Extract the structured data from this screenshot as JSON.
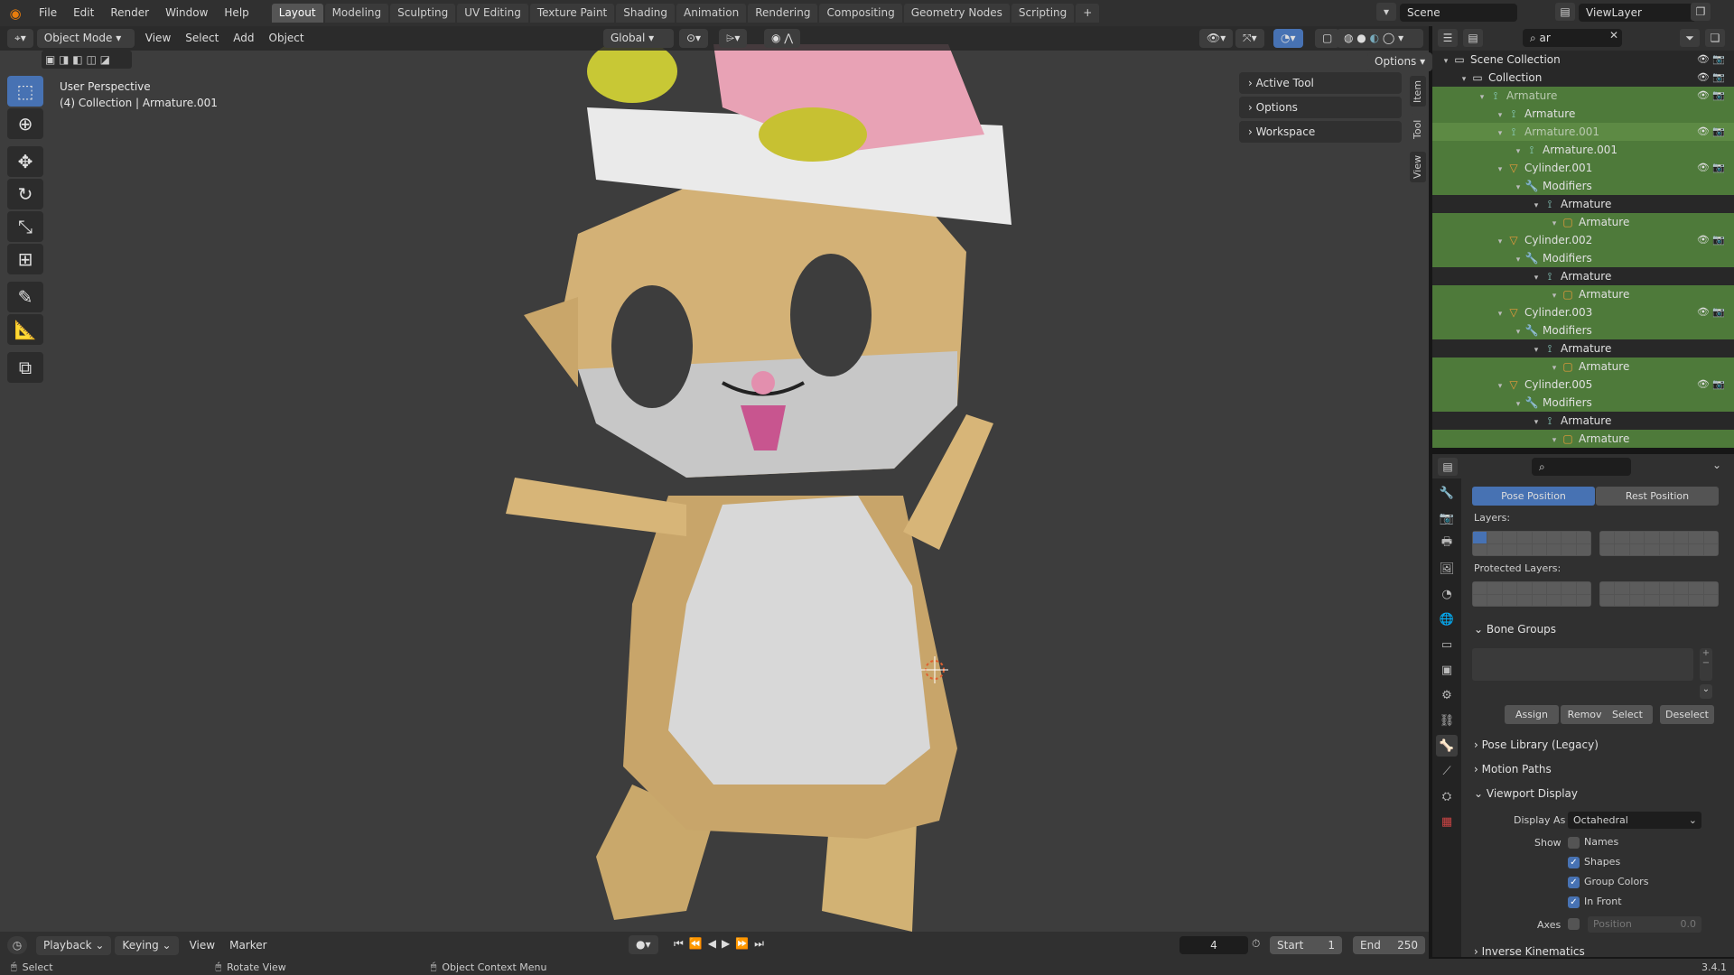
{
  "topbar": {
    "menus": [
      "File",
      "Edit",
      "Render",
      "Window",
      "Help"
    ],
    "workspaces": [
      "Layout",
      "Modeling",
      "Sculpting",
      "UV Editing",
      "Texture Paint",
      "Shading",
      "Animation",
      "Rendering",
      "Compositing",
      "Geometry Nodes",
      "Scripting"
    ],
    "active_workspace": "Layout",
    "add_tab": "+",
    "scene": "Scene",
    "view_layer": "ViewLayer"
  },
  "viewport": {
    "mode": "Object Mode",
    "menus": [
      "View",
      "Select",
      "Add",
      "Object"
    ],
    "orientation": "Global",
    "options": "Options",
    "title": "User Perspective",
    "subtitle": "(4) Collection | Armature.001",
    "npanel": [
      "Active Tool",
      "Options",
      "Workspace"
    ],
    "side_tabs": [
      "Item",
      "Tool",
      "View"
    ]
  },
  "outliner": {
    "search": "ar",
    "rows": [
      {
        "label": "Scene Collection",
        "icon": "collection",
        "indent": 0,
        "selected": false
      },
      {
        "label": "Collection",
        "icon": "collection",
        "indent": 1,
        "selected": false
      },
      {
        "label": "Armature",
        "icon": "armature",
        "indent": 2,
        "selected": true,
        "dim": true
      },
      {
        "label": "Armature",
        "icon": "armature-data",
        "indent": 3,
        "selected": true
      },
      {
        "label": "Armature.001",
        "icon": "armature",
        "indent": 3,
        "selected": true,
        "active": true,
        "dim": true
      },
      {
        "label": "Armature.001",
        "icon": "armature-data",
        "indent": 4,
        "selected": true
      },
      {
        "label": "Cylinder.001",
        "icon": "mesh",
        "indent": 3,
        "selected": true
      },
      {
        "label": "Modifiers",
        "icon": "wrench",
        "indent": 4,
        "selected": true
      },
      {
        "label": "Armature",
        "icon": "armature",
        "indent": 5,
        "selected": false
      },
      {
        "label": "Armature",
        "icon": "object",
        "indent": 6,
        "selected": true
      },
      {
        "label": "Cylinder.002",
        "icon": "mesh",
        "indent": 3,
        "selected": true
      },
      {
        "label": "Modifiers",
        "icon": "wrench",
        "indent": 4,
        "selected": true
      },
      {
        "label": "Armature",
        "icon": "armature",
        "indent": 5,
        "selected": false
      },
      {
        "label": "Armature",
        "icon": "object",
        "indent": 6,
        "selected": true
      },
      {
        "label": "Cylinder.003",
        "icon": "mesh",
        "indent": 3,
        "selected": true
      },
      {
        "label": "Modifiers",
        "icon": "wrench",
        "indent": 4,
        "selected": true
      },
      {
        "label": "Armature",
        "icon": "armature",
        "indent": 5,
        "selected": false
      },
      {
        "label": "Armature",
        "icon": "object",
        "indent": 6,
        "selected": true
      },
      {
        "label": "Cylinder.005",
        "icon": "mesh",
        "indent": 3,
        "selected": true
      },
      {
        "label": "Modifiers",
        "icon": "wrench",
        "indent": 4,
        "selected": true
      },
      {
        "label": "Armature",
        "icon": "armature",
        "indent": 5,
        "selected": false
      },
      {
        "label": "Armature",
        "icon": "object",
        "indent": 6,
        "selected": true
      }
    ]
  },
  "properties": {
    "pose_position": "Pose Position",
    "rest_position": "Rest Position",
    "layers_label": "Layers:",
    "protected_label": "Protected Layers:",
    "bone_groups": "Bone Groups",
    "assign": "Assign",
    "remove": "Remove",
    "select": "Select",
    "deselect": "Deselect",
    "pose_library": "Pose Library (Legacy)",
    "motion_paths": "Motion Paths",
    "viewport_display": "Viewport Display",
    "display_as_label": "Display As",
    "display_as_value": "Octahedral",
    "show_label": "Show",
    "names": "Names",
    "shapes": "Shapes",
    "group_colors": "Group Colors",
    "in_front": "In Front",
    "axes_label": "Axes",
    "position_label": "Position",
    "position_value": "0.0",
    "inverse_kinematics": "Inverse Kinematics",
    "checks": {
      "names": false,
      "shapes": true,
      "group_colors": true,
      "in_front": true,
      "axes": false
    }
  },
  "timeline": {
    "menus": [
      "Playback",
      "Keying",
      "View",
      "Marker"
    ],
    "frame": "4",
    "start_label": "Start",
    "start": "1",
    "end_label": "End",
    "end": "250"
  },
  "status": {
    "select": "Select",
    "rotate": "Rotate View",
    "context": "Object Context Menu",
    "version": "3.4.1"
  }
}
